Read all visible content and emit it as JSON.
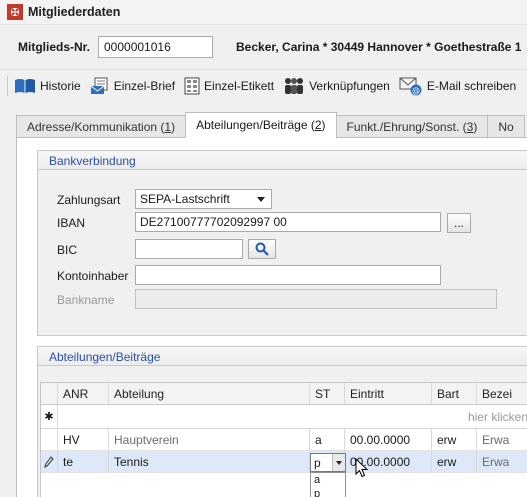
{
  "window": {
    "title": "Mitgliederdaten",
    "app_icon": "club-logo-icon"
  },
  "header": {
    "member_no_label": "Mitglieds-Nr.",
    "member_no_value": "0000001016",
    "member_info": "Becker, Carina * 30449 Hannover * Goethestraße 1"
  },
  "toolbar": {
    "items": [
      {
        "label": "Historie",
        "icon": "book-icon"
      },
      {
        "label": "Einzel-Brief",
        "icon": "letter-icon"
      },
      {
        "label": "Einzel-Etikett",
        "icon": "label-sheet-icon"
      },
      {
        "label": "Verknüpfungen",
        "icon": "people-icon"
      },
      {
        "label": "E-Mail schreiben",
        "icon": "email-icon"
      }
    ]
  },
  "tabs": [
    {
      "label": "Adresse/Kommunikation",
      "count": "1"
    },
    {
      "label": "Abteilungen/Beiträge",
      "count": "2"
    },
    {
      "label": "Funkt./Ehrung/Sonst.",
      "count": "3"
    },
    {
      "label": "No"
    }
  ],
  "bank": {
    "title": "Bankverbindung",
    "payment_label": "Zahlungsart",
    "payment_value": "SEPA-Lastschrift",
    "iban_label": "IBAN",
    "iban_value": "DE27100777702092997 00",
    "iban_button": "...",
    "bic_label": "BIC",
    "bic_value": "",
    "owner_label": "Kontoinhaber",
    "owner_value": "",
    "bankname_label": "Bankname",
    "bankname_value": ""
  },
  "departments": {
    "title": "Abteilungen/Beiträge",
    "columns": [
      "ANR",
      "Abteilung",
      "ST",
      "Eintritt",
      "Bart",
      "Bezei"
    ],
    "new_row_hint": "hier klicken",
    "rows": [
      {
        "anr": "HV",
        "abteilung": "Hauptverein",
        "st": "a",
        "eintritt": "00.00.0000",
        "bart": "erw",
        "bez": "Erwa"
      },
      {
        "anr": "te",
        "abteilung": "Tennis",
        "st": "p",
        "eintritt": "00.00.0000",
        "bart": "erw",
        "bez": "Erwa"
      }
    ],
    "st_dropdown_options": [
      "a",
      "p"
    ]
  },
  "colors": {
    "group_title": "#2a4ea6",
    "selected_row": "#dde8f8"
  }
}
